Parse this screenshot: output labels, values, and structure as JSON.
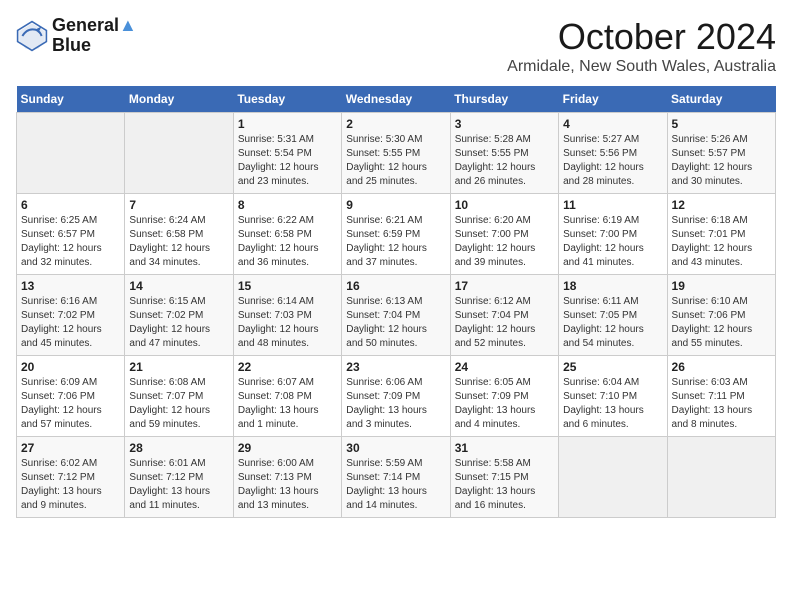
{
  "logo": {
    "line1": "General",
    "line2": "Blue"
  },
  "title": "October 2024",
  "subtitle": "Armidale, New South Wales, Australia",
  "headers": [
    "Sunday",
    "Monday",
    "Tuesday",
    "Wednesday",
    "Thursday",
    "Friday",
    "Saturday"
  ],
  "weeks": [
    [
      {
        "day": "",
        "info": ""
      },
      {
        "day": "",
        "info": ""
      },
      {
        "day": "1",
        "info": "Sunrise: 5:31 AM\nSunset: 5:54 PM\nDaylight: 12 hours and 23 minutes."
      },
      {
        "day": "2",
        "info": "Sunrise: 5:30 AM\nSunset: 5:55 PM\nDaylight: 12 hours and 25 minutes."
      },
      {
        "day": "3",
        "info": "Sunrise: 5:28 AM\nSunset: 5:55 PM\nDaylight: 12 hours and 26 minutes."
      },
      {
        "day": "4",
        "info": "Sunrise: 5:27 AM\nSunset: 5:56 PM\nDaylight: 12 hours and 28 minutes."
      },
      {
        "day": "5",
        "info": "Sunrise: 5:26 AM\nSunset: 5:57 PM\nDaylight: 12 hours and 30 minutes."
      }
    ],
    [
      {
        "day": "6",
        "info": "Sunrise: 6:25 AM\nSunset: 6:57 PM\nDaylight: 12 hours and 32 minutes."
      },
      {
        "day": "7",
        "info": "Sunrise: 6:24 AM\nSunset: 6:58 PM\nDaylight: 12 hours and 34 minutes."
      },
      {
        "day": "8",
        "info": "Sunrise: 6:22 AM\nSunset: 6:58 PM\nDaylight: 12 hours and 36 minutes."
      },
      {
        "day": "9",
        "info": "Sunrise: 6:21 AM\nSunset: 6:59 PM\nDaylight: 12 hours and 37 minutes."
      },
      {
        "day": "10",
        "info": "Sunrise: 6:20 AM\nSunset: 7:00 PM\nDaylight: 12 hours and 39 minutes."
      },
      {
        "day": "11",
        "info": "Sunrise: 6:19 AM\nSunset: 7:00 PM\nDaylight: 12 hours and 41 minutes."
      },
      {
        "day": "12",
        "info": "Sunrise: 6:18 AM\nSunset: 7:01 PM\nDaylight: 12 hours and 43 minutes."
      }
    ],
    [
      {
        "day": "13",
        "info": "Sunrise: 6:16 AM\nSunset: 7:02 PM\nDaylight: 12 hours and 45 minutes."
      },
      {
        "day": "14",
        "info": "Sunrise: 6:15 AM\nSunset: 7:02 PM\nDaylight: 12 hours and 47 minutes."
      },
      {
        "day": "15",
        "info": "Sunrise: 6:14 AM\nSunset: 7:03 PM\nDaylight: 12 hours and 48 minutes."
      },
      {
        "day": "16",
        "info": "Sunrise: 6:13 AM\nSunset: 7:04 PM\nDaylight: 12 hours and 50 minutes."
      },
      {
        "day": "17",
        "info": "Sunrise: 6:12 AM\nSunset: 7:04 PM\nDaylight: 12 hours and 52 minutes."
      },
      {
        "day": "18",
        "info": "Sunrise: 6:11 AM\nSunset: 7:05 PM\nDaylight: 12 hours and 54 minutes."
      },
      {
        "day": "19",
        "info": "Sunrise: 6:10 AM\nSunset: 7:06 PM\nDaylight: 12 hours and 55 minutes."
      }
    ],
    [
      {
        "day": "20",
        "info": "Sunrise: 6:09 AM\nSunset: 7:06 PM\nDaylight: 12 hours and 57 minutes."
      },
      {
        "day": "21",
        "info": "Sunrise: 6:08 AM\nSunset: 7:07 PM\nDaylight: 12 hours and 59 minutes."
      },
      {
        "day": "22",
        "info": "Sunrise: 6:07 AM\nSunset: 7:08 PM\nDaylight: 13 hours and 1 minute."
      },
      {
        "day": "23",
        "info": "Sunrise: 6:06 AM\nSunset: 7:09 PM\nDaylight: 13 hours and 3 minutes."
      },
      {
        "day": "24",
        "info": "Sunrise: 6:05 AM\nSunset: 7:09 PM\nDaylight: 13 hours and 4 minutes."
      },
      {
        "day": "25",
        "info": "Sunrise: 6:04 AM\nSunset: 7:10 PM\nDaylight: 13 hours and 6 minutes."
      },
      {
        "day": "26",
        "info": "Sunrise: 6:03 AM\nSunset: 7:11 PM\nDaylight: 13 hours and 8 minutes."
      }
    ],
    [
      {
        "day": "27",
        "info": "Sunrise: 6:02 AM\nSunset: 7:12 PM\nDaylight: 13 hours and 9 minutes."
      },
      {
        "day": "28",
        "info": "Sunrise: 6:01 AM\nSunset: 7:12 PM\nDaylight: 13 hours and 11 minutes."
      },
      {
        "day": "29",
        "info": "Sunrise: 6:00 AM\nSunset: 7:13 PM\nDaylight: 13 hours and 13 minutes."
      },
      {
        "day": "30",
        "info": "Sunrise: 5:59 AM\nSunset: 7:14 PM\nDaylight: 13 hours and 14 minutes."
      },
      {
        "day": "31",
        "info": "Sunrise: 5:58 AM\nSunset: 7:15 PM\nDaylight: 13 hours and 16 minutes."
      },
      {
        "day": "",
        "info": ""
      },
      {
        "day": "",
        "info": ""
      }
    ]
  ]
}
